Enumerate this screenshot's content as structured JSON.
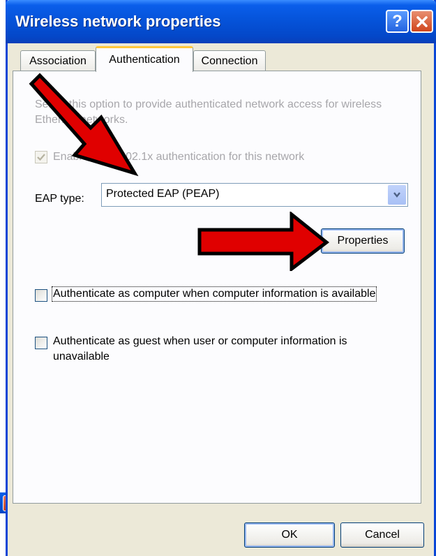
{
  "dialog": {
    "title": "Wireless network properties",
    "help_label": "?",
    "close_glyph": "✕"
  },
  "tabs": [
    {
      "label": "Association",
      "active": false
    },
    {
      "label": "Authentication",
      "active": true
    },
    {
      "label": "Connection",
      "active": false
    }
  ],
  "authentication": {
    "description": "Select this option to provide authenticated network access for wireless Ethernet networks.",
    "enable_8021x_label": "Enable IEEE 802.1x authentication for this network",
    "enable_8021x_checked": true,
    "enable_8021x_disabled": true,
    "eap_type_label": "EAP type:",
    "eap_type_value": "Protected EAP (PEAP)",
    "properties_button": "Properties",
    "auth_computer_label": "Authenticate as computer when computer information is available",
    "auth_computer_checked": false,
    "auth_guest_label_line1": "Authenticate as guest when user or computer information is",
    "auth_guest_label_line2": "unavailable",
    "auth_guest_checked": false
  },
  "footer": {
    "ok_label": "OK",
    "cancel_label": "Cancel"
  },
  "annotations": {
    "arrow_color": "#E00000",
    "arrow_outline": "#000000"
  },
  "icons": [
    "help-icon",
    "close-icon",
    "chevron-down-icon",
    "checkmark-icon",
    "red-arrow-icon"
  ]
}
